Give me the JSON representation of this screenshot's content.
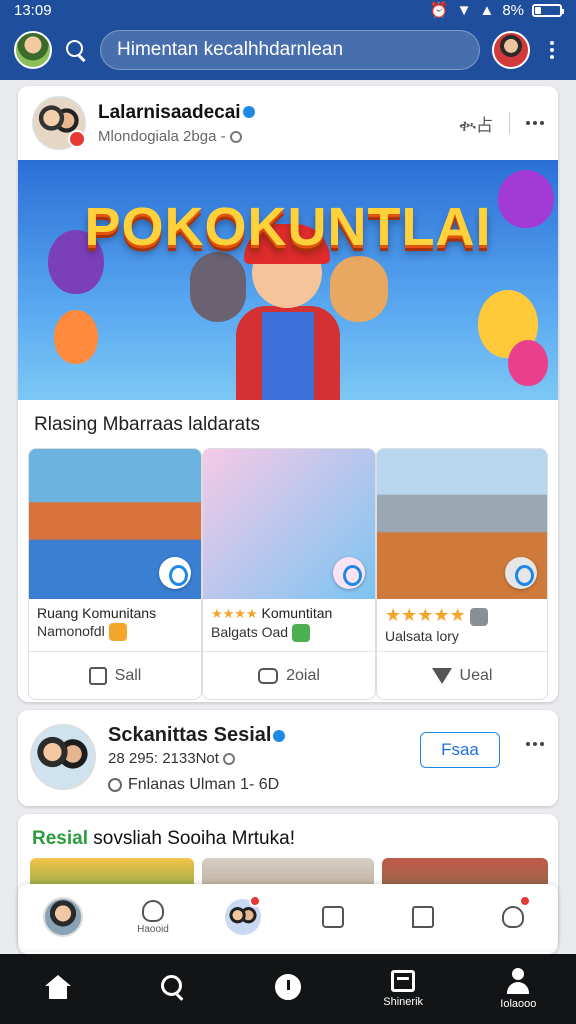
{
  "status": {
    "time": "13:09",
    "battery": "8%"
  },
  "appbar": {
    "search_text": "Himentan kecalhhdarnlean"
  },
  "post": {
    "author": "Lalarnisaadecai",
    "meta": "Mlondogiala 2bga -",
    "action_label": "ቊ占",
    "banner_title": "POKOKUNTLAI",
    "section_title": "Rlasing Mbarraas laldarats",
    "items": [
      {
        "line1": "Ruang Komunitans",
        "line2": "Namonofdl",
        "action": "Sall",
        "colors": [
          "#d9713b",
          "#3a7fd1"
        ]
      },
      {
        "line1": "Komuntitan",
        "stars": "★★★★",
        "line2": "Balgats Oad",
        "action": "2oial",
        "colors": [
          "#f7c9e7",
          "#7bc4f2"
        ]
      },
      {
        "line1": "",
        "stars": "★★★★★",
        "line2": "Ualsata lory",
        "action": "Ueal",
        "colors": [
          "#9aa6b2",
          "#cf7a3a"
        ]
      }
    ]
  },
  "page": {
    "name": "Sckanittas Sesial",
    "meta1": "28 295: 2133Not",
    "meta2": "Fnlanas Ulman 1-",
    "meta2_suffix": "6D",
    "follow_label": "Fsaa"
  },
  "feed": {
    "title_green": "Resial",
    "title_rest": "sovsliah Sooiha Mrtuka!"
  },
  "shortcuts": {
    "home_label": "Haooid"
  },
  "bottomnav": [
    {
      "label": ""
    },
    {
      "label": ""
    },
    {
      "label": ""
    },
    {
      "label": "Shinerik"
    },
    {
      "label": "Iolaooo"
    }
  ],
  "colors": {
    "brand": "#1f4f9c",
    "accent": "#1e88e5",
    "alert": "#e53935",
    "green": "#2e9b3e"
  }
}
